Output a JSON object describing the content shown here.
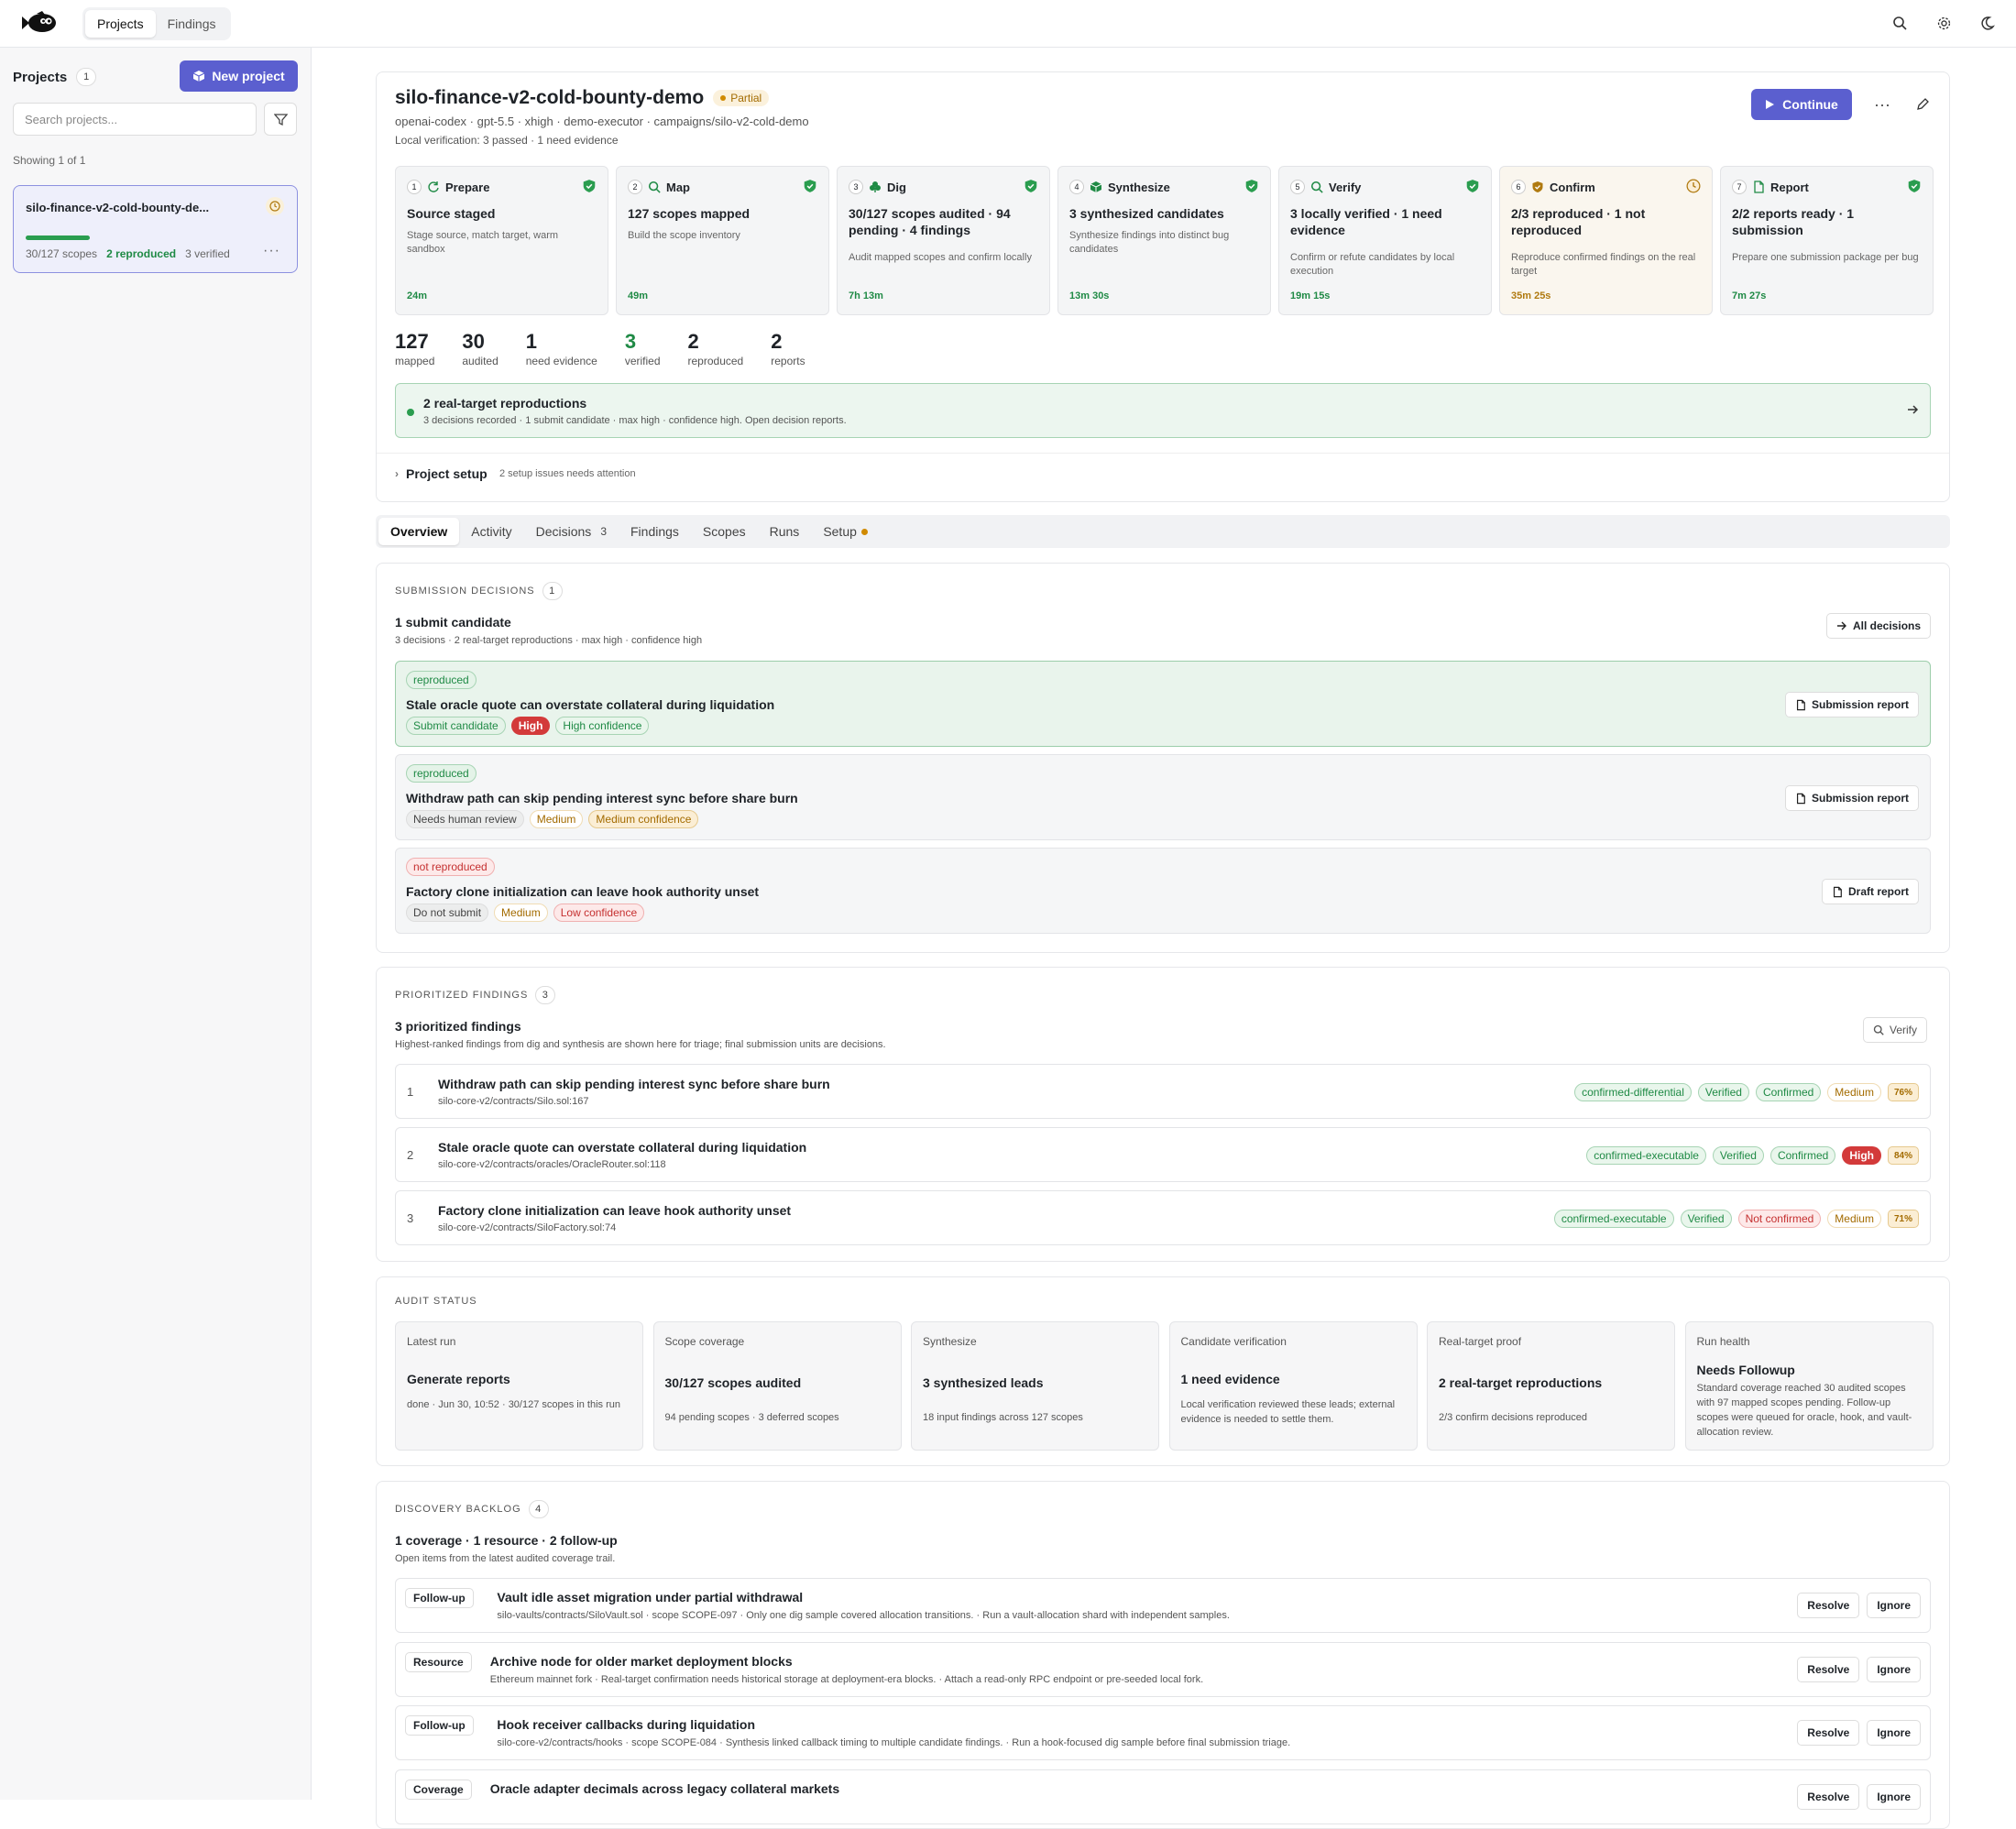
{
  "nav": {
    "tabs": [
      "Projects",
      "Findings"
    ]
  },
  "sidebar": {
    "title": "Projects",
    "count": "1",
    "new_project": "New project",
    "search_placeholder": "Search projects...",
    "showing": "Showing 1 of 1",
    "project": {
      "name": "silo-finance-v2-cold-bounty-de...",
      "progress_fraction": 0.236,
      "scopes": "30/127 scopes",
      "reproduced": "2 reproduced",
      "verified": "3 verified"
    }
  },
  "project": {
    "title": "silo-finance-v2-cold-bounty-demo",
    "status": "Partial",
    "meta": "openai-codex · gpt-5.5 · xhigh · demo-executor · campaigns/silo-v2-cold-demo",
    "verification": "Local verification: 3 passed · 1 need evidence",
    "continue": "Continue"
  },
  "stages": [
    {
      "num": "1",
      "name": "Prepare",
      "icon": "refresh-icon",
      "title": "Source staged",
      "desc": "Stage source, match target, warm sandbox",
      "time": "24m",
      "state": "ok"
    },
    {
      "num": "2",
      "name": "Map",
      "icon": "search-icon",
      "title": "127 scopes mapped",
      "desc": "Build the scope inventory",
      "time": "49m",
      "state": "ok"
    },
    {
      "num": "3",
      "name": "Dig",
      "icon": "clover-icon",
      "title": "30/127 scopes audited · 94 pending · 4 findings",
      "desc": "Audit mapped scopes and confirm locally",
      "time": "7h 13m",
      "state": "ok"
    },
    {
      "num": "4",
      "name": "Synthesize",
      "icon": "package-icon",
      "title": "3 synthesized candidates",
      "desc": "Synthesize findings into distinct bug candidates",
      "time": "13m 30s",
      "state": "ok"
    },
    {
      "num": "5",
      "name": "Verify",
      "icon": "search-icon",
      "title": "3 locally verified · 1 need evidence",
      "desc": "Confirm or refute candidates by local execution",
      "time": "19m 15s",
      "state": "ok"
    },
    {
      "num": "6",
      "name": "Confirm",
      "icon": "shield-icon",
      "title": "2/3 reproduced · 1 not reproduced",
      "desc": "Reproduce confirmed findings on the real target",
      "time": "35m 25s",
      "state": "warn"
    },
    {
      "num": "7",
      "name": "Report",
      "icon": "file-icon",
      "title": "2/2 reports ready · 1 submission",
      "desc": "Prepare one submission package per bug",
      "time": "7m 27s",
      "state": "ok"
    }
  ],
  "stats": [
    {
      "value": "127",
      "label": "mapped"
    },
    {
      "value": "30",
      "label": "audited"
    },
    {
      "value": "1",
      "label": "need evidence"
    },
    {
      "value": "3",
      "label": "verified"
    },
    {
      "value": "2",
      "label": "reproduced"
    },
    {
      "value": "2",
      "label": "reports"
    }
  ],
  "alert": {
    "title": "2 real-target reproductions",
    "sub": "3 decisions recorded · 1 submit candidate · max high · confidence high. Open decision reports."
  },
  "setup": {
    "title": "Project setup",
    "sub": "2 setup issues needs attention"
  },
  "tabs": [
    {
      "label": "Overview"
    },
    {
      "label": "Activity"
    },
    {
      "label": "Decisions",
      "count": "3"
    },
    {
      "label": "Findings"
    },
    {
      "label": "Scopes"
    },
    {
      "label": "Runs"
    },
    {
      "label": "Setup"
    }
  ],
  "decisions": {
    "label": "SUBMISSION DECISIONS",
    "count": "1",
    "title": "1 submit candidate",
    "sub": "3 decisions · 2 real-target reproductions · max high · confidence high",
    "all_button": "All decisions",
    "items": [
      {
        "status": "reproduced",
        "title": "Stale oracle quote can overstate collateral during liquidation",
        "tags": [
          "Submit candidate",
          "High",
          "High confidence"
        ],
        "action": "Submission report"
      },
      {
        "status": "reproduced",
        "title": "Withdraw path can skip pending interest sync before share burn",
        "tags": [
          "Needs human review",
          "Medium",
          "Medium confidence"
        ],
        "action": "Submission report"
      },
      {
        "status": "not reproduced",
        "title": "Factory clone initialization can leave hook authority unset",
        "tags": [
          "Do not submit",
          "Medium",
          "Low confidence"
        ],
        "action": "Draft report"
      }
    ]
  },
  "findings": {
    "label": "PRIORITIZED FINDINGS",
    "count": "3",
    "title": "3 prioritized findings",
    "sub": "Highest-ranked findings from dig and synthesis are shown here for triage; final submission units are decisions.",
    "verify_button": "Verify",
    "items": [
      {
        "n": "1",
        "title": "Withdraw path can skip pending interest sync before share burn",
        "path": "silo-core-v2/contracts/Silo.sol:167",
        "tags": [
          "confirmed-differential",
          "Verified",
          "Confirmed",
          "Medium"
        ],
        "pct": "76%"
      },
      {
        "n": "2",
        "title": "Stale oracle quote can overstate collateral during liquidation",
        "path": "silo-core-v2/contracts/oracles/OracleRouter.sol:118",
        "tags": [
          "confirmed-executable",
          "Verified",
          "Confirmed",
          "High"
        ],
        "pct": "84%"
      },
      {
        "n": "3",
        "title": "Factory clone initialization can leave hook authority unset",
        "path": "silo-core-v2/contracts/SiloFactory.sol:74",
        "tags": [
          "confirmed-executable",
          "Verified",
          "Not confirmed",
          "Medium"
        ],
        "pct": "71%"
      }
    ]
  },
  "audit": {
    "label": "AUDIT STATUS",
    "cards": [
      {
        "label": "Latest run",
        "title": "Generate reports",
        "sub": "done · Jun 30, 10:52 · 30/127 scopes in this run"
      },
      {
        "label": "Scope coverage",
        "title": "30/127 scopes audited",
        "sub": "94 pending scopes · 3 deferred scopes"
      },
      {
        "label": "Synthesize",
        "title": "3 synthesized leads",
        "sub": "18 input findings across 127 scopes"
      },
      {
        "label": "Candidate verification",
        "title": "1 need evidence",
        "sub": "Local verification reviewed these leads; external evidence is needed to settle them."
      },
      {
        "label": "Real-target proof",
        "title": "2 real-target reproductions",
        "sub": "2/3 confirm decisions reproduced"
      },
      {
        "label": "Run health",
        "title": "Needs Followup",
        "sub": "Standard coverage reached 30 audited scopes with 97 mapped scopes pending. Follow-up scopes were queued for oracle, hook, and vault-allocation review."
      }
    ]
  },
  "backlog": {
    "label": "DISCOVERY BACKLOG",
    "count": "4",
    "title": "1 coverage · 1 resource · 2 follow-up",
    "sub": "Open items from the latest audited coverage trail.",
    "resolve": "Resolve",
    "ignore": "Ignore",
    "items": [
      {
        "tag": "Follow-up",
        "title": "Vault idle asset migration under partial withdrawal",
        "sub": "silo-vaults/contracts/SiloVault.sol · scope SCOPE-097 · Only one dig sample covered allocation transitions. · Run a vault-allocation shard with independent samples."
      },
      {
        "tag": "Resource",
        "title": "Archive node for older market deployment blocks",
        "sub": "Ethereum mainnet fork · Real-target confirmation needs historical storage at deployment-era blocks. · Attach a read-only RPC endpoint or pre-seeded local fork."
      },
      {
        "tag": "Follow-up",
        "title": "Hook receiver callbacks during liquidation",
        "sub": "silo-core-v2/contracts/hooks · scope SCOPE-084 · Synthesis linked callback timing to multiple candidate findings. · Run a hook-focused dig sample before final submission triage."
      },
      {
        "tag": "Coverage",
        "title": "Oracle adapter decimals across legacy collateral markets",
        "sub": ""
      }
    ]
  },
  "colors": {
    "accent": "#5b5fcf",
    "green": "#1f8a45",
    "amber": "#a36b00",
    "red": "#d33a3a"
  }
}
